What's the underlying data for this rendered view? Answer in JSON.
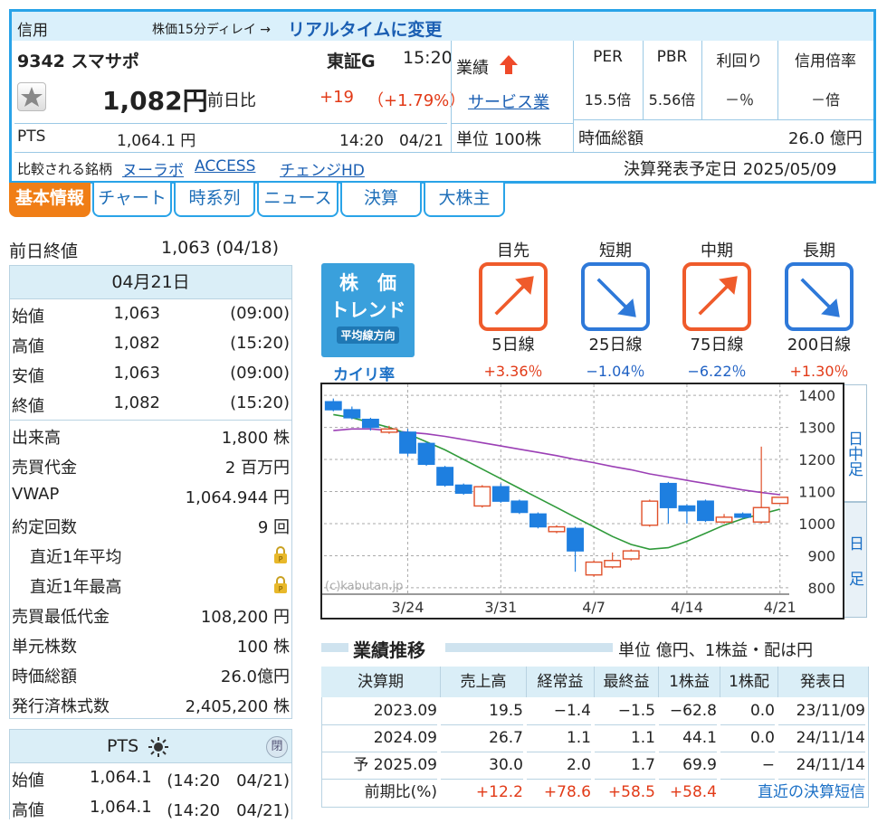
{
  "header": {
    "category": "信用",
    "delay_note": "株価15分ディレイ →",
    "realtime_link": "リアルタイムに変更",
    "code_name": "9342 スマサポ",
    "market": "東証G",
    "time": "15:20",
    "price": "1,082円",
    "change_label": "前日比",
    "change": "+19",
    "change_pct": "（+1.79%）",
    "gyoseki_label": "業績",
    "sector": "サービス業",
    "unit": "単位 100株",
    "pts_label": "PTS",
    "pts_price": "1,064.1 円",
    "pts_time": "14:20　04/21",
    "metrics_heads": [
      "PER",
      "PBR",
      "利回り",
      "信用倍率"
    ],
    "metrics_vals": [
      "15.5倍",
      "5.56倍",
      "－％",
      "－倍"
    ],
    "market_cap_label": "時価総額",
    "market_cap": "26.0 億円",
    "compare_label": "比較される銘柄",
    "compare_links": [
      "ヌーラボ",
      "ACCESS",
      "チェンジHD"
    ],
    "earnings_date": "決算発表予定日  2025/05/09"
  },
  "tabs": [
    "基本情報",
    "チャート",
    "時系列",
    "ニュース",
    "決算",
    "大株主"
  ],
  "prev_close": {
    "label": "前日終値",
    "value": "1,063 (04/18)"
  },
  "day_table": {
    "date": "04月21日",
    "rows": [
      {
        "label": "始値",
        "value": "1,063",
        "time": "(09:00)"
      },
      {
        "label": "高値",
        "value": "1,082",
        "time": "(15:20)"
      },
      {
        "label": "安値",
        "value": "1,063",
        "time": "(09:00)"
      },
      {
        "label": "終値",
        "value": "1,082",
        "time": "(15:20)"
      }
    ]
  },
  "stats": [
    {
      "label": "出来高",
      "value": "1,800 株"
    },
    {
      "label": "売買代金",
      "value": "2 百万円"
    },
    {
      "label": "VWAP",
      "value": "1,064.944 円"
    },
    {
      "label": "約定回数",
      "value": "9 回"
    },
    {
      "label": "直近1年平均",
      "value": ""
    },
    {
      "label": "直近1年最高",
      "value": ""
    },
    {
      "label": "売買最低代金",
      "value": "108,200 円"
    },
    {
      "label": "単元株数",
      "value": "100 株"
    },
    {
      "label": "時価総額",
      "value": "26.0億円"
    },
    {
      "label": "発行済株式数",
      "value": "2,405,200 株"
    }
  ],
  "pts_table": {
    "title": "PTS",
    "rows": [
      {
        "label": "始値",
        "value": "1,064.1",
        "time": "(14:20　04/21)"
      },
      {
        "label": "高値",
        "value": "1,064.1",
        "time": "(14:20　04/21)"
      }
    ]
  },
  "trend": {
    "logo_lines": [
      "株　価",
      "トレンド",
      "平均線方向"
    ],
    "kairi_label": "カイリ率",
    "periods": [
      {
        "title": "目先",
        "line": "5日線",
        "dir": "up",
        "pct": "+3.36％",
        "color": "#e23a17"
      },
      {
        "title": "短期",
        "line": "25日線",
        "dir": "down",
        "pct": "−1.04％",
        "color": "#1f61c4"
      },
      {
        "title": "中期",
        "line": "75日線",
        "dir": "up",
        "pct": "−6.22％",
        "color": "#1f61c4"
      },
      {
        "title": "長期",
        "line": "200日線",
        "dir": "down",
        "pct": "+1.30％",
        "color": "#e23a17"
      }
    ]
  },
  "chart_data": {
    "type": "candlestick",
    "y_ticks": [
      "1400",
      "1300",
      "1200",
      "1100",
      "1000",
      "900",
      "800"
    ],
    "x_ticks": [
      "3/24",
      "3/31",
      "4/7",
      "4/14",
      "4/21"
    ],
    "ylim": [
      780,
      1420
    ],
    "watermark": "(c)kabutan.jp",
    "side_tabs": [
      "日中足",
      "日足"
    ],
    "candles": [
      {
        "o": 1380,
        "c": 1355,
        "h": 1390,
        "l": 1350
      },
      {
        "o": 1355,
        "c": 1330,
        "h": 1365,
        "l": 1325
      },
      {
        "o": 1325,
        "c": 1300,
        "h": 1330,
        "l": 1290
      },
      {
        "o": 1285,
        "c": 1295,
        "h": 1305,
        "l": 1280
      },
      {
        "o": 1285,
        "c": 1220,
        "h": 1295,
        "l": 1210
      },
      {
        "o": 1250,
        "c": 1185,
        "h": 1255,
        "l": 1180
      },
      {
        "o": 1175,
        "c": 1120,
        "h": 1180,
        "l": 1115
      },
      {
        "o": 1120,
        "c": 1095,
        "h": 1125,
        "l": 1090
      },
      {
        "o": 1055,
        "c": 1115,
        "h": 1120,
        "l": 1050
      },
      {
        "o": 1115,
        "c": 1070,
        "h": 1125,
        "l": 1065
      },
      {
        "o": 1070,
        "c": 1035,
        "h": 1075,
        "l": 1030
      },
      {
        "o": 1030,
        "c": 990,
        "h": 1035,
        "l": 985
      },
      {
        "o": 975,
        "c": 990,
        "h": 995,
        "l": 970
      },
      {
        "o": 985,
        "c": 915,
        "h": 990,
        "l": 850
      },
      {
        "o": 840,
        "c": 880,
        "h": 885,
        "l": 835
      },
      {
        "o": 865,
        "c": 885,
        "h": 910,
        "l": 860
      },
      {
        "o": 890,
        "c": 915,
        "h": 920,
        "l": 885
      },
      {
        "o": 995,
        "c": 1070,
        "h": 1075,
        "l": 990
      },
      {
        "o": 1125,
        "c": 1050,
        "h": 1130,
        "l": 1000
      },
      {
        "o": 1055,
        "c": 1040,
        "h": 1060,
        "l": 1000
      },
      {
        "o": 1070,
        "c": 1010,
        "h": 1075,
        "l": 1005
      },
      {
        "o": 1005,
        "c": 1020,
        "h": 1030,
        "l": 1000
      },
      {
        "o": 1030,
        "c": 1020,
        "h": 1035,
        "l": 1015
      },
      {
        "o": 1005,
        "c": 1050,
        "h": 1240,
        "l": 1000
      },
      {
        "o": 1063,
        "c": 1082,
        "h": 1082,
        "l": 1063
      }
    ],
    "ma_green": [
      1340,
      1330,
      1315,
      1300,
      1280,
      1255,
      1230,
      1200,
      1170,
      1140,
      1110,
      1080,
      1050,
      1020,
      990,
      960,
      935,
      920,
      925,
      945,
      970,
      995,
      1015,
      1030,
      1045
    ],
    "ma_purple": [
      1290,
      1295,
      1295,
      1290,
      1285,
      1280,
      1272,
      1262,
      1252,
      1242,
      1232,
      1222,
      1212,
      1200,
      1190,
      1178,
      1168,
      1155,
      1145,
      1135,
      1125,
      1115,
      1105,
      1097,
      1090
    ]
  },
  "results": {
    "title": "業績推移",
    "unit_note": "単位 億円、1株益・配は円",
    "headers": [
      "決算期",
      "売上高",
      "経常益",
      "最終益",
      "1株益",
      "1株配",
      "発表日"
    ],
    "rows": [
      [
        "2023.09",
        "19.5",
        "−1.4",
        "−1.5",
        "−62.8",
        "0.0",
        "23/11/09"
      ],
      [
        "2024.09",
        "26.7",
        "1.1",
        "1.1",
        "44.1",
        "0.0",
        "24/11/14"
      ],
      [
        "予 2025.09",
        "30.0",
        "2.0",
        "1.7",
        "69.9",
        "−",
        "24/11/14"
      ]
    ],
    "yoy_label": "前期比(%)",
    "yoy": [
      "+12.2",
      "+78.6",
      "+58.5",
      "+58.4"
    ],
    "yoy_link": "直近の決算短信"
  },
  "colors": {
    "accent": "#29a3e8",
    "up": "#e23a17",
    "down": "#1f61c4",
    "tab_active": "#f07e16"
  }
}
